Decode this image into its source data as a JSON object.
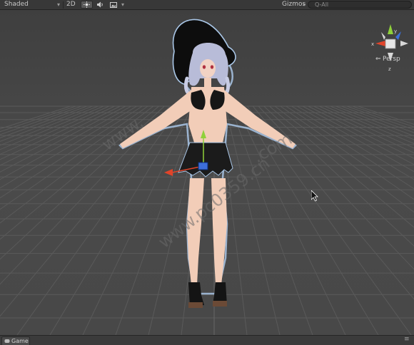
{
  "toolbar": {
    "draw_mode": "Shaded",
    "mode_2d": "2D",
    "gizmos": "Gizmos",
    "search_placeholder": "Q-All"
  },
  "scene": {
    "projection_label": "Persp",
    "gizmo_axes": [
      "x",
      "y",
      "z"
    ]
  },
  "bottom_bar": {
    "game_tab_label": "Game"
  },
  "colors": {
    "axis_x": "#e0442a",
    "axis_y": "#8fd13a",
    "axis_z": "#3d6fd9"
  }
}
